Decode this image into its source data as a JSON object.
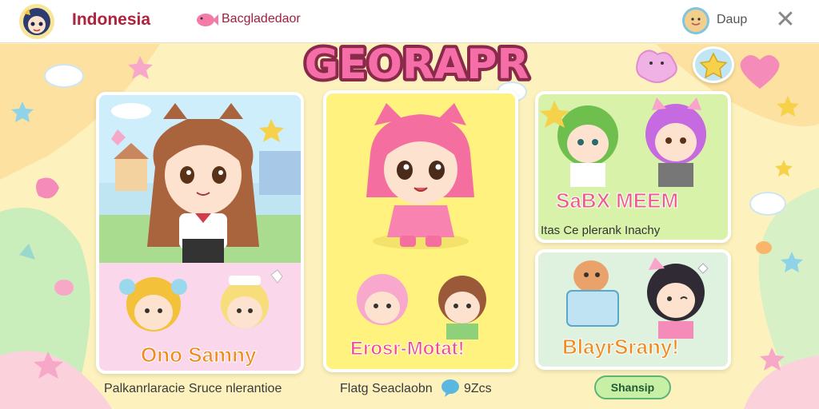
{
  "header": {
    "app_title": "Indonesia",
    "topic_label": "Bacgladedaor",
    "user_name": "Daup",
    "close_symbol": "✕"
  },
  "logo": {
    "text": "GEORAPR"
  },
  "cards": {
    "left": {
      "caption_big": "Ono Samny"
    },
    "middle": {
      "caption_big": "Erosr-Motat!"
    },
    "right_top": {
      "caption_big": "SaBX MEEM",
      "subcaption": "Itas Ce plerank Inachy"
    },
    "right_bottom": {
      "caption_big": "BlayrSrany!"
    }
  },
  "footer": {
    "left_caption": "Palkanrlaracie Sruce nlerantioe",
    "middle_caption_a": "Flatg Seaclaobn",
    "middle_caption_b": "9Zcs",
    "share_button": "Shansip"
  },
  "icons": {
    "avatar": "anime-girl-avatar-icon",
    "topic": "pink-fish-icon",
    "user": "smiley-avatar-icon",
    "close": "close-icon",
    "star": "star-icon",
    "bubble": "speech-bubble-icon"
  },
  "colors": {
    "background": "#fdf3c0",
    "accent": "#e6447a",
    "card_left": "#fbd7ec",
    "card_middle": "#fff27e",
    "card_right_top": "#d8f2a9",
    "card_right_bottom": "#dff1df"
  }
}
